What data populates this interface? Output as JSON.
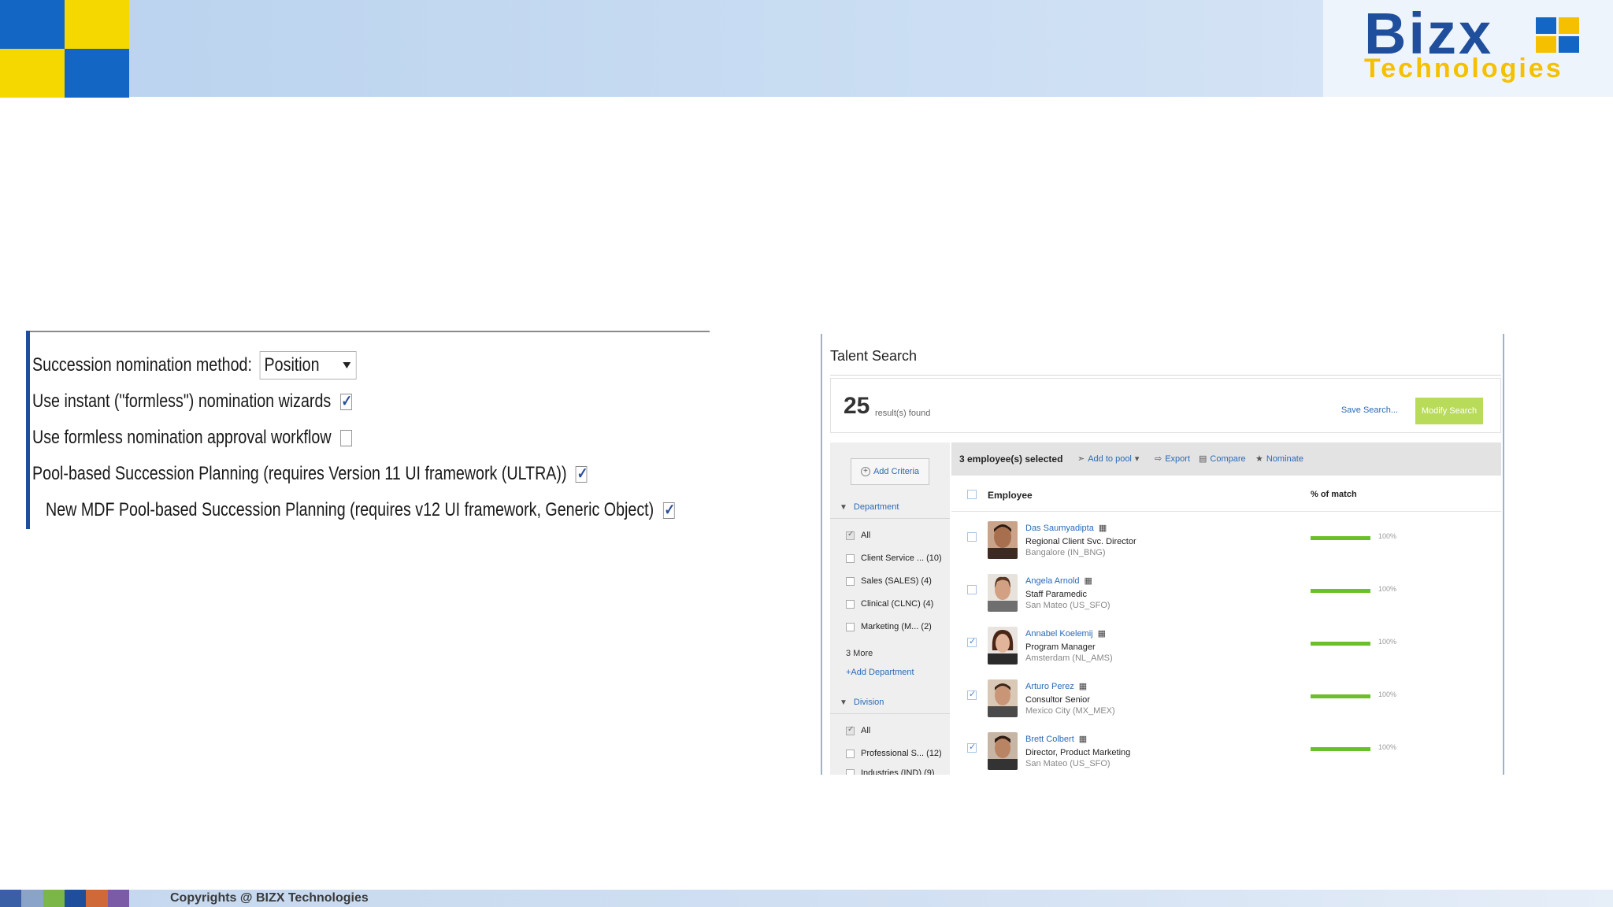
{
  "brand": {
    "name": "Bizx",
    "subtitle": "Technologies",
    "name_color": "#1f4e9c",
    "subtitle_color": "#f5c000",
    "logo_colors": [
      "#f5d800",
      "#1466c4"
    ]
  },
  "settings": {
    "method_label": "Succession nomination method:",
    "method_value": "Position",
    "rows": [
      {
        "label": "Use instant (\"formless\") nomination wizards",
        "checked": true
      },
      {
        "label": "Use formless nomination approval workflow",
        "checked": false
      },
      {
        "label": "Pool-based Succession Planning (requires Version 11 UI framework (ULTRA))",
        "checked": true
      },
      {
        "label": "New MDF Pool-based Succession Planning (requires v12 UI framework, Generic Object)",
        "checked": true
      }
    ]
  },
  "talent_search": {
    "title": "Talent Search",
    "result_count": "25",
    "result_label": "result(s) found",
    "save_search": "Save Search...",
    "modify_search": "Modify Search",
    "add_criteria": "Add Criteria",
    "department": {
      "header": "Department",
      "items": [
        {
          "label": "All",
          "checked": true
        },
        {
          "label": "Client Service ... (10)",
          "checked": false
        },
        {
          "label": "Sales (SALES)  (4)",
          "checked": false
        },
        {
          "label": "Clinical (CLNC)  (4)",
          "checked": false
        },
        {
          "label": "Marketing (M...  (2)",
          "checked": false
        }
      ],
      "more": "3 More",
      "add": "+Add Department"
    },
    "division": {
      "header": "Division",
      "items": [
        {
          "label": "All",
          "checked": true
        },
        {
          "label": "Professional S... (12)",
          "checked": false
        },
        {
          "label": "Industries (IND)  (9)",
          "checked": false
        }
      ]
    },
    "toolbar": {
      "selected": "3 employee(s) selected",
      "add_to_pool": "Add to pool",
      "export": "Export",
      "compare": "Compare",
      "nominate": "Nominate"
    },
    "columns": {
      "employee": "Employee",
      "match": "% of match"
    },
    "employees": [
      {
        "name": "Das Saumyadipta",
        "title": "Regional Client Svc. Director",
        "location": "Bangalore (IN_BNG)",
        "match": "100%",
        "match_value": 100,
        "checked": false
      },
      {
        "name": "Angela Arnold",
        "title": "Staff Paramedic",
        "location": "San Mateo (US_SFO)",
        "match": "100%",
        "match_value": 100,
        "checked": false
      },
      {
        "name": "Annabel Koelemij",
        "title": "Program Manager",
        "location": "Amsterdam (NL_AMS)",
        "match": "100%",
        "match_value": 100,
        "checked": true
      },
      {
        "name": "Arturo Perez",
        "title": "Consultor Senior",
        "location": "Mexico City (MX_MEX)",
        "match": "100%",
        "match_value": 100,
        "checked": true
      },
      {
        "name": "Brett Colbert",
        "title": "Director, Product Marketing",
        "location": "San Mateo (US_SFO)",
        "match": "100%",
        "match_value": 100,
        "checked": true
      }
    ]
  },
  "footer": {
    "text": "Copyrights @ BIZX Technologies",
    "strip_colors": [
      "#3b5fa6",
      "#8aa3c9",
      "#7ab648",
      "#1f4e9c",
      "#d0693a",
      "#7b5aa6"
    ]
  }
}
